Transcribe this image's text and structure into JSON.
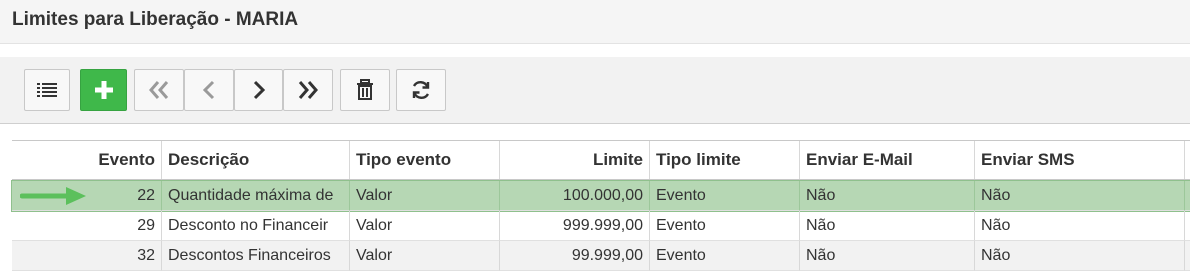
{
  "page": {
    "title": "Limites para Liberação - MARIA"
  },
  "toolbar": {
    "buttons": [
      {
        "name": "list-button",
        "icon": "list-icon"
      },
      {
        "name": "add-button",
        "icon": "plus-icon"
      },
      {
        "name": "first-button",
        "icon": "double-chevron-left-icon"
      },
      {
        "name": "prev-button",
        "icon": "chevron-left-icon"
      },
      {
        "name": "next-button",
        "icon": "chevron-right-icon"
      },
      {
        "name": "last-button",
        "icon": "double-chevron-right-icon"
      },
      {
        "name": "delete-button",
        "icon": "trash-icon"
      },
      {
        "name": "refresh-button",
        "icon": "refresh-icon"
      }
    ],
    "accent_add": "#3fb84a"
  },
  "table": {
    "columns": [
      "Evento",
      "Descrição",
      "Tipo evento",
      "Limite",
      "Tipo limite",
      "Enviar E-Mail",
      "Enviar SMS"
    ],
    "rows": [
      {
        "evento": "22",
        "descricao": "Quantidade máxima de",
        "tipo_evento": "Valor",
        "limite": "100.000,00",
        "tipo_limite": "Evento",
        "email": "Não",
        "sms": "Não"
      },
      {
        "evento": "29",
        "descricao": "Desconto no Financeir",
        "tipo_evento": "Valor",
        "limite": "999.999,00",
        "tipo_limite": "Evento",
        "email": "Não",
        "sms": "Não"
      },
      {
        "evento": "32",
        "descricao": "Descontos Financeiros",
        "tipo_evento": "Valor",
        "limite": "99.999,00",
        "tipo_limite": "Evento",
        "email": "Não",
        "sms": "Não"
      }
    ],
    "selected_color": "#b6d7b4",
    "arrow_color": "#5cc05c"
  }
}
